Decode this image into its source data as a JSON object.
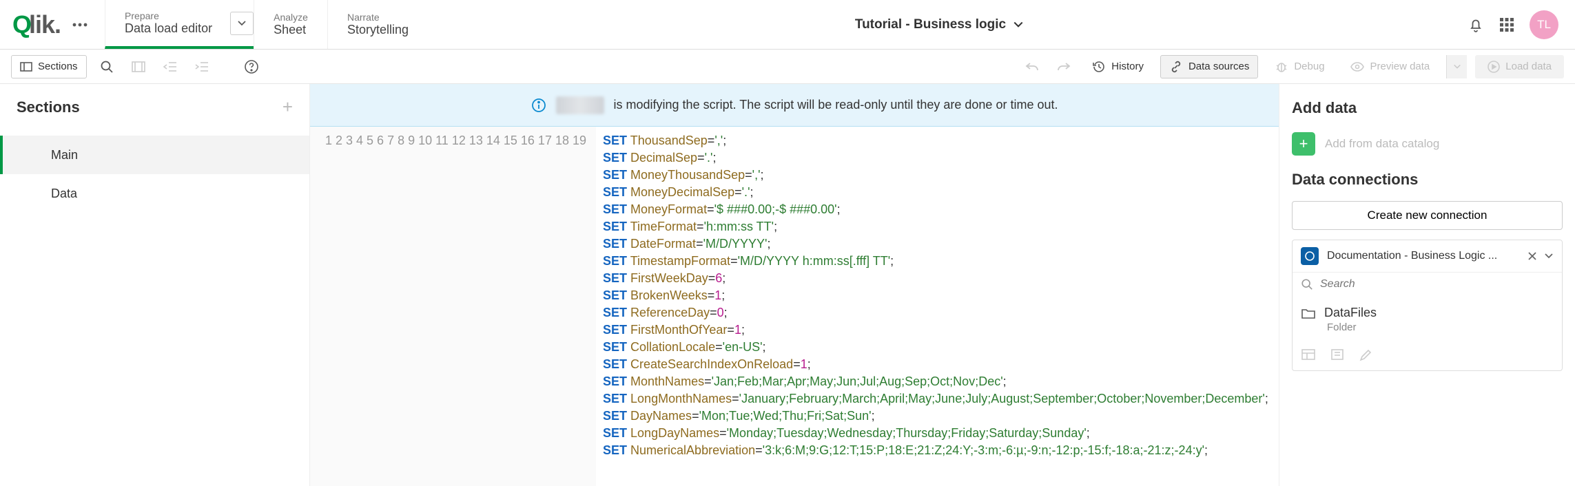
{
  "nav": {
    "prepare_sup": "Prepare",
    "prepare_main": "Data load editor",
    "analyze_sup": "Analyze",
    "analyze_main": "Sheet",
    "narrate_sup": "Narrate",
    "narrate_main": "Storytelling"
  },
  "app_title": "Tutorial - Business logic",
  "avatar_initials": "TL",
  "toolbar": {
    "sections": "Sections",
    "history": "History",
    "data_sources": "Data sources",
    "debug": "Debug",
    "preview": "Preview data",
    "load": "Load data"
  },
  "sections": {
    "title": "Sections",
    "items": [
      "Main",
      "Data"
    ],
    "active_index": 0
  },
  "banner_text": "is modifying the script. The script will be read-only until they are done or time out.",
  "script_lines": [
    {
      "n": 1,
      "var": "ThousandSep",
      "val": "','"
    },
    {
      "n": 2,
      "var": "DecimalSep",
      "val": "'.'"
    },
    {
      "n": 3,
      "var": "MoneyThousandSep",
      "val": "','"
    },
    {
      "n": 4,
      "var": "MoneyDecimalSep",
      "val": "'.'"
    },
    {
      "n": 5,
      "var": "MoneyFormat",
      "val": "'$ ###0.00;-$ ###0.00'"
    },
    {
      "n": 6,
      "var": "TimeFormat",
      "val": "'h:mm:ss TT'"
    },
    {
      "n": 7,
      "var": "DateFormat",
      "val": "'M/D/YYYY'"
    },
    {
      "n": 8,
      "var": "TimestampFormat",
      "val": "'M/D/YYYY h:mm:ss[.fff] TT'"
    },
    {
      "n": 9,
      "var": "FirstWeekDay",
      "num": "6"
    },
    {
      "n": 10,
      "var": "BrokenWeeks",
      "num": "1"
    },
    {
      "n": 11,
      "var": "ReferenceDay",
      "num": "0"
    },
    {
      "n": 12,
      "var": "FirstMonthOfYear",
      "num": "1"
    },
    {
      "n": 13,
      "var": "CollationLocale",
      "val": "'en-US'"
    },
    {
      "n": 14,
      "var": "CreateSearchIndexOnReload",
      "num": "1"
    },
    {
      "n": 15,
      "var": "MonthNames",
      "val": "'Jan;Feb;Mar;Apr;May;Jun;Jul;Aug;Sep;Oct;Nov;Dec'"
    },
    {
      "n": 16,
      "var": "LongMonthNames",
      "val": "'January;February;March;April;May;June;July;August;September;October;November;December'"
    },
    {
      "n": 17,
      "var": "DayNames",
      "val": "'Mon;Tue;Wed;Thu;Fri;Sat;Sun'"
    },
    {
      "n": 18,
      "var": "LongDayNames",
      "val": "'Monday;Tuesday;Wednesday;Thursday;Friday;Saturday;Sunday'"
    },
    {
      "n": 19,
      "var": "NumericalAbbreviation",
      "val": "'3:k;6:M;9:G;12:T;15:P;18:E;21:Z;24:Y;-3:m;-6:µ;-9:n;-12:p;-15:f;-18:a;-21:z;-24:y'"
    }
  ],
  "right": {
    "add_data_title": "Add data",
    "add_catalog": "Add from data catalog",
    "connections_title": "Data connections",
    "create_connection": "Create new connection",
    "connection_name": "Documentation - Business Logic ...",
    "search_placeholder": "Search",
    "datafiles": "DataFiles",
    "datafiles_sub": "Folder"
  }
}
